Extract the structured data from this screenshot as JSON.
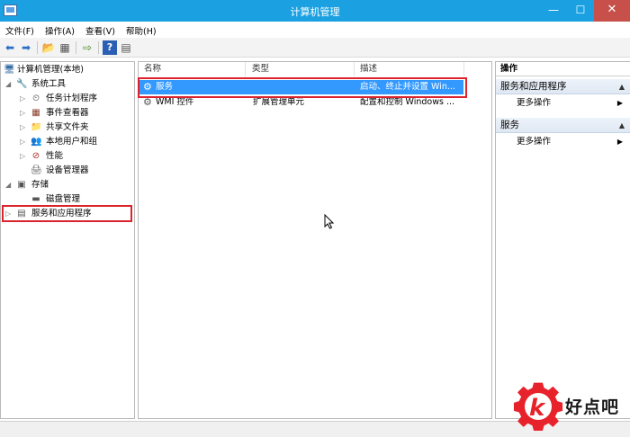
{
  "window": {
    "title": "计算机管理",
    "minimize": "—",
    "maximize": "☐",
    "close": "✕"
  },
  "menu": [
    "文件(F)",
    "操作(A)",
    "查看(V)",
    "帮助(H)"
  ],
  "tree": [
    {
      "label": "计算机管理(本地)",
      "icon": "computer-icon",
      "glyph": "🖥",
      "expander": ""
    },
    {
      "label": "系统工具",
      "icon": "tools-icon",
      "glyph": "🔧",
      "expander": "◢"
    },
    {
      "label": "任务计划程序",
      "icon": "clock-icon",
      "glyph": "⏲",
      "expander": "▷"
    },
    {
      "label": "事件查看器",
      "icon": "event-viewer-icon",
      "glyph": "▦",
      "expander": "▷"
    },
    {
      "label": "共享文件夹",
      "icon": "shared-folder-icon",
      "glyph": "📁",
      "expander": "▷"
    },
    {
      "label": "本地用户和组",
      "icon": "users-icon",
      "glyph": "👥",
      "expander": "▷"
    },
    {
      "label": "性能",
      "icon": "performance-icon",
      "glyph": "⊘",
      "expander": "▷"
    },
    {
      "label": "设备管理器",
      "icon": "device-manager-icon",
      "glyph": "🖨",
      "expander": ""
    },
    {
      "label": "存储",
      "icon": "storage-icon",
      "glyph": "▣",
      "expander": "◢"
    },
    {
      "label": "磁盘管理",
      "icon": "disk-icon",
      "glyph": "▬",
      "expander": ""
    },
    {
      "label": "服务和应用程序",
      "icon": "services-apps-icon",
      "glyph": "▤",
      "expander": "▷"
    }
  ],
  "list": {
    "columns": [
      "名称",
      "类型",
      "描述"
    ],
    "rows": [
      {
        "name": "服务",
        "type": "",
        "desc": "启动、终止并设置 Win...",
        "icon": "gear-icon",
        "glyph": "⚙"
      },
      {
        "name": "WMI 控件",
        "type": "扩展管理单元",
        "desc": "配置和控制 Windows ...",
        "icon": "wmi-icon",
        "glyph": "⚙"
      }
    ]
  },
  "actions": {
    "header": "操作",
    "groups": [
      {
        "title": "服务和应用程序",
        "item": "更多操作"
      },
      {
        "title": "服务",
        "item": "更多操作"
      }
    ]
  },
  "watermark": {
    "text": "好点吧"
  },
  "colors": {
    "titlebar": "#1ba1e2",
    "close": "#c7504b",
    "selection": "#3399ff",
    "highlight_box": "#d9242e"
  }
}
